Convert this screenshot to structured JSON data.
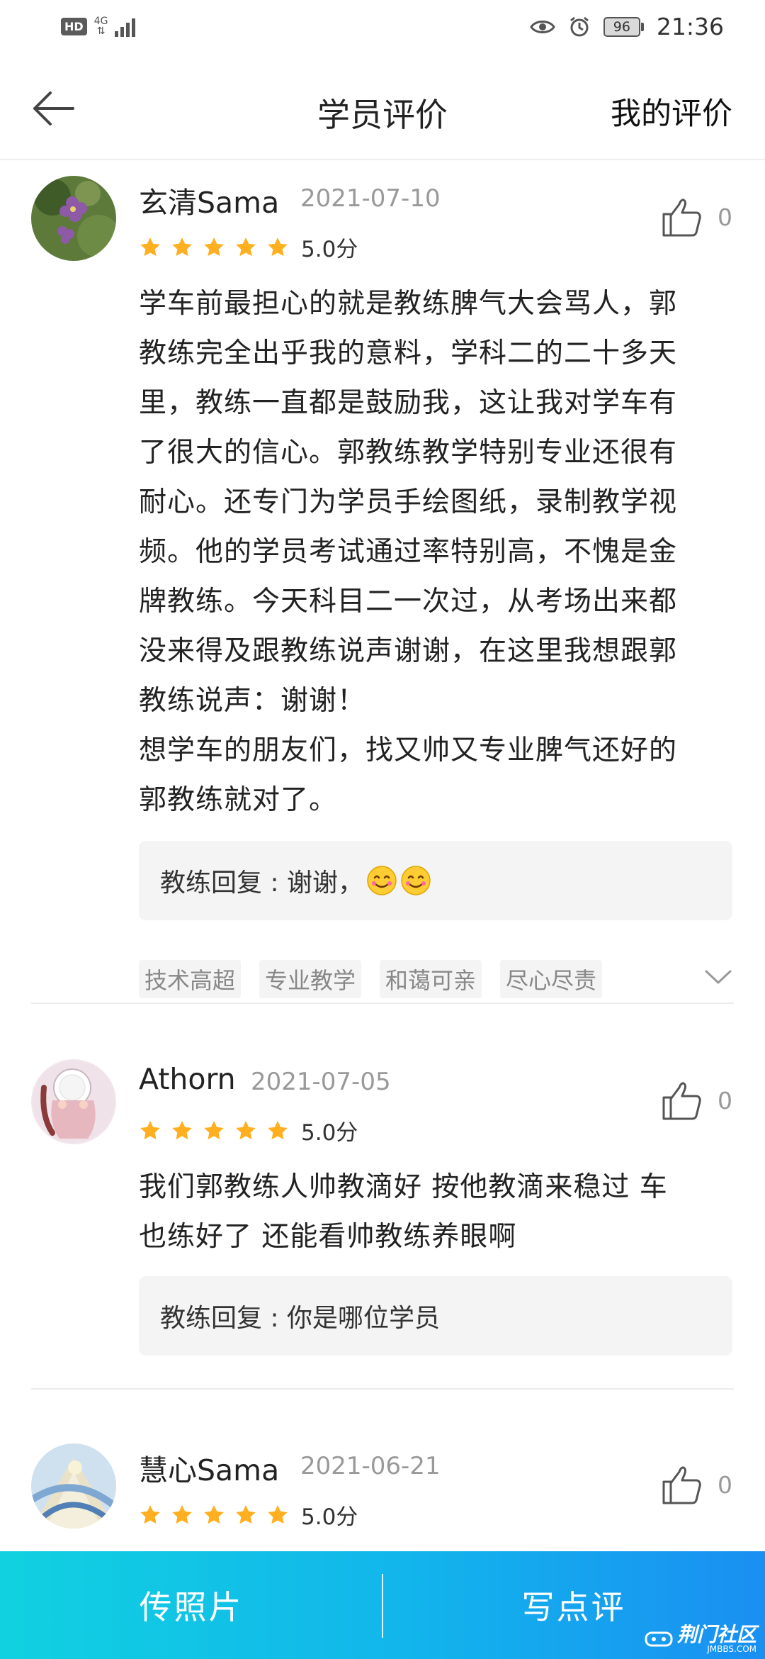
{
  "status_bar": {
    "left_badge": "HD",
    "network": "4G",
    "battery": "96",
    "time": "21:36",
    "icons": [
      "eye-icon",
      "alarm-icon"
    ]
  },
  "nav": {
    "title": "学员评价",
    "action": "我的评价"
  },
  "reviews": [
    {
      "name": "玄清Sama",
      "date": "2021-07-10",
      "rating": 5,
      "score_text": "5.0分",
      "likes": "0",
      "text": "学车前最担心的就是教练脾气大会骂人，郭\n教练完全出乎我的意料，学科二的二十多天\n里，教练一直都是鼓励我，这让我对学车有\n了很大的信心。郭教练教学特别专业还很有\n耐心。还专门为学员手绘图纸，录制教学视\n频。他的学员考试通过率特别高，不愧是金\n牌教练。今天科目二一次过，从考场出来都\n没来得及跟教练说声谢谢，在这里我想跟郭\n教练说声：谢谢！\n想学车的朋友们，找又帅又专业脾气还好的\n郭教练就对了。",
      "reply": "教练回复 : 谢谢，",
      "tags": [
        "技术高超",
        "专业教学",
        "和蔼可亲",
        "尽心尽责"
      ]
    },
    {
      "name": "Athorn",
      "date": "2021-07-05",
      "rating": 5,
      "score_text": "5.0分",
      "likes": "0",
      "text": "我们郭教练人帅教滴好 按他教滴来稳过 车\n也练好了 还能看帅教练养眼啊",
      "reply": "教练回复 : 你是哪位学员"
    },
    {
      "name": "慧心Sama",
      "date": "2021-06-21",
      "rating": 5,
      "score_text": "5.0分",
      "likes": "0"
    }
  ],
  "bottom_bar": {
    "upload_label": "传照片",
    "review_label": "写点评"
  },
  "watermark": {
    "title": "荆门社区",
    "sub": "JMBBS.COM"
  },
  "colors": {
    "star": "#ffaf1f",
    "bar_start": "#11d1e0",
    "bar_end": "#1a8ff2",
    "muted": "#999999"
  }
}
